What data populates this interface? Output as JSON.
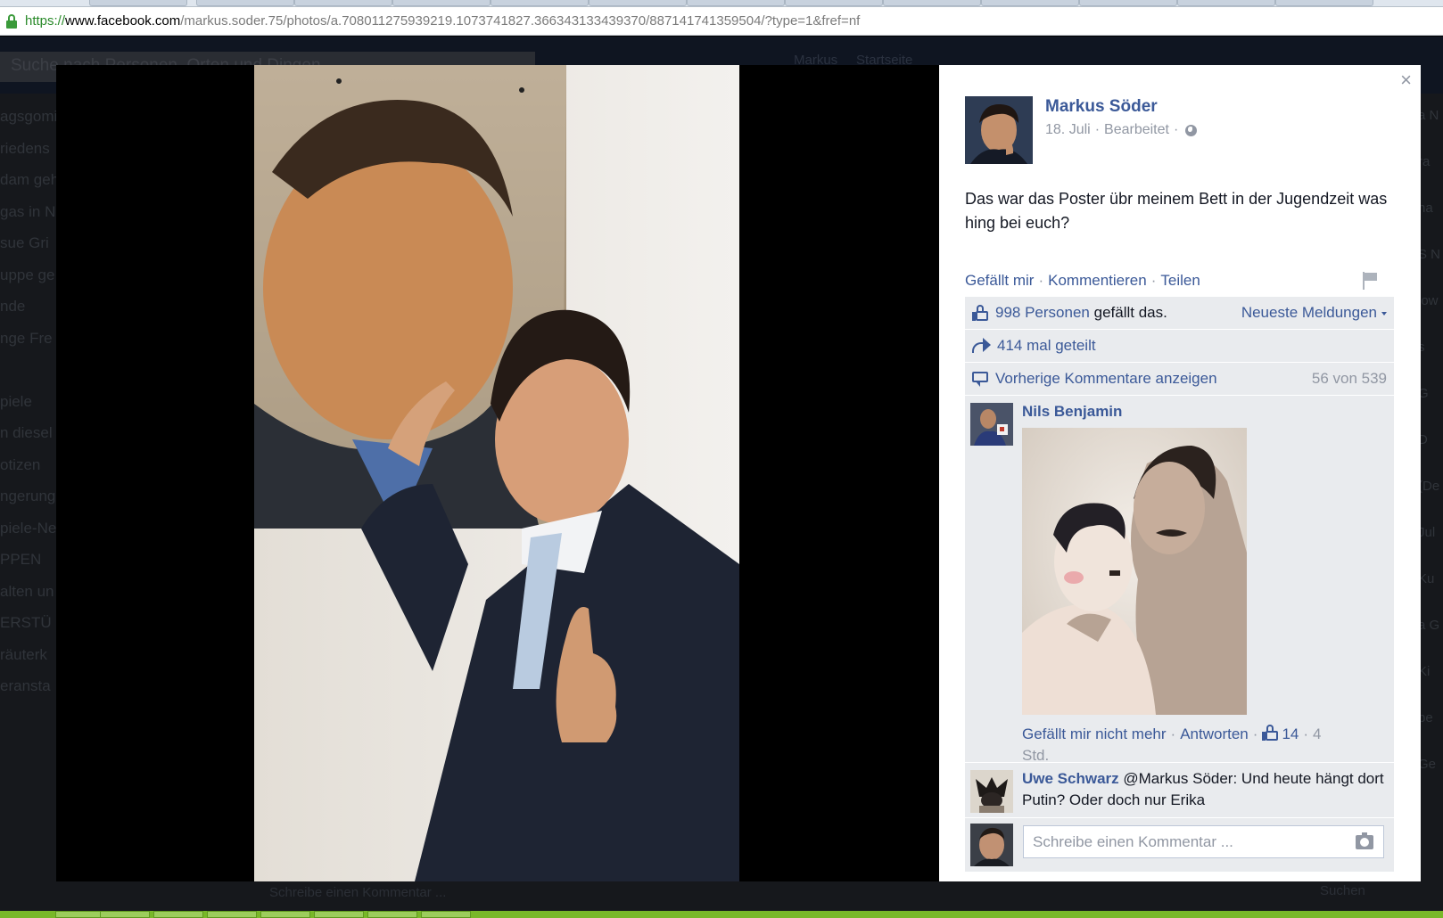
{
  "browser": {
    "url_scheme": "https://",
    "url_host": "www.facebook.com",
    "url_path": "/markus.soder.75/photos/a.708011275939219.1073741827.366343133439370/887141741359504/?type=1&fref=nf"
  },
  "background": {
    "search_placeholder": "Suche nach Personen, Orten und Dingen",
    "nav_user": "Markus",
    "nav_start": "Startseite",
    "left_items": [
      "agsgomi",
      "riedens",
      "dam geh",
      "gas in N",
      "sue Gri",
      "uppe ge",
      "nde",
      "nge Fre",
      "",
      "piele",
      "n diesel",
      "otizen",
      "ngerung",
      "piele-Ne",
      "PPEN",
      "alten un",
      "ERSTÜ",
      "räuterk",
      "eransta"
    ],
    "right_items": [
      "a N",
      "ra",
      "ha",
      "S N",
      "low",
      "s",
      "G",
      "D",
      "(De",
      "Jul",
      "Ku",
      "a G",
      "Ki",
      "be",
      "Ge"
    ],
    "bottom_comment": "Schreibe einen Kommentar ...",
    "bottom_search": "Suchen"
  },
  "post": {
    "author": "Markus Söder",
    "date": "18. Juli",
    "edited": "Bearbeitet",
    "meta_sep": "·",
    "text": "Das war das Poster übr meinem Bett in der Jugendzeit was hing bei euch?",
    "actions": {
      "like": "Gefällt mir",
      "comment": "Kommentieren",
      "share": "Teilen"
    },
    "likes_count": "998 Personen",
    "likes_suffix": "gefällt das.",
    "sort_label": "Neueste Meldungen",
    "shares": "414 mal geteilt",
    "prev_comments": "Vorherige Kommentare anzeigen",
    "comment_count": "56 von 539"
  },
  "comments": [
    {
      "author": "Nils Benjamin",
      "text": "",
      "actions": {
        "unlike": "Gefällt mir nicht mehr",
        "reply": "Antworten",
        "likes": "14",
        "time": "4 Std."
      }
    },
    {
      "author": "Uwe Schwarz",
      "text": "@Markus Söder: Und heute hängt dort Putin? Oder doch nur Erika"
    }
  ],
  "compose": {
    "placeholder": "Schreibe einen Kommentar ..."
  },
  "ui": {
    "close": "×"
  }
}
